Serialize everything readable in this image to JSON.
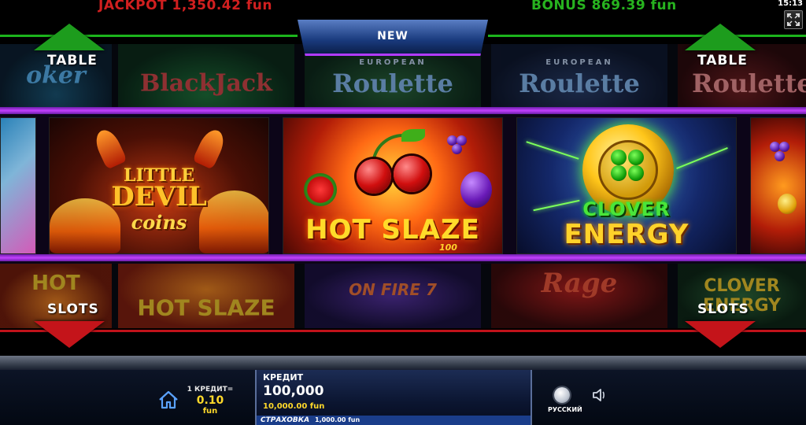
{
  "header": {
    "jackpot": "JACKPOT 1,350.42 fun",
    "bonus": "BONUS 869.39 fun",
    "clock": "15:13",
    "new_label": "NEW"
  },
  "categories": {
    "top_left": "TABLE",
    "top_right": "TABLE",
    "bottom_left": "SLOTS",
    "bottom_right": "SLOTS"
  },
  "featured_games": {
    "little_devil": {
      "line1": "LITTLE",
      "line2": "DEVIL",
      "line3": "coins"
    },
    "hot_slaze": {
      "title": "HOT SLAZE",
      "sub": "100"
    },
    "clover_energy": {
      "line1": "CLOVER",
      "line2": "ENERGY"
    }
  },
  "table_row": [
    {
      "label": "oker"
    },
    {
      "label": "BlackJack"
    },
    {
      "label": "Roulette",
      "sub": "EUROPEAN"
    },
    {
      "label": "Roulette",
      "sub": "EUROPEAN"
    },
    {
      "label": "Roulette"
    }
  ],
  "slots_row": [
    {
      "label": "HOT"
    },
    {
      "label": "HOT SLAZE"
    },
    {
      "label": "ON FIRE 7"
    },
    {
      "label": "Rage"
    },
    {
      "label": "CLOVER ENERGY"
    }
  ],
  "footer": {
    "credit_rate_label": "1 КРЕДИТ=",
    "credit_rate_value": "0.10",
    "credit_rate_unit": "fun",
    "credit_title": "КРЕДИТ",
    "credit_value": "100,000",
    "credit_fun": "10,000.00 fun",
    "insurance_label": "СТРАХОВКА",
    "insurance_value": "1,000.00 fun",
    "language": "РУССКИЙ"
  },
  "colors": {
    "jackpot": "#d11f1f",
    "bonus": "#27b31f",
    "accent_purple": "#c440ff",
    "table_arrow": "#1d9c1d",
    "slots_arrow": "#c4141a"
  },
  "icons": [
    "fullscreen-icon",
    "home-icon",
    "language-icon",
    "sound-icon"
  ]
}
